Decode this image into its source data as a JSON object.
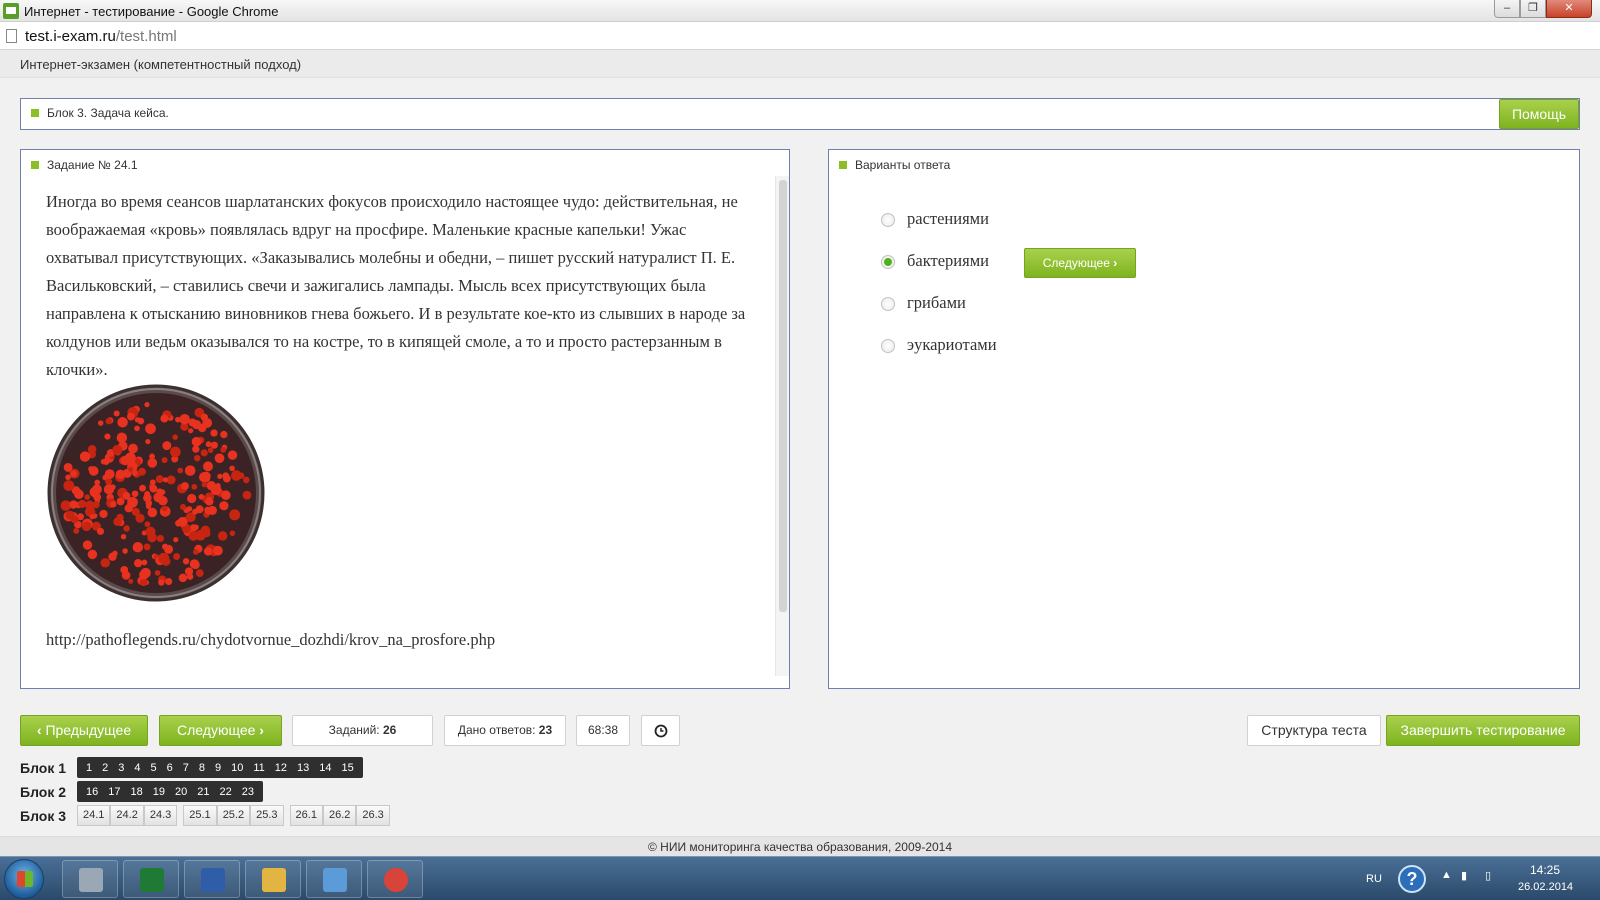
{
  "window": {
    "title": "Интернет - тестирование - Google Chrome",
    "controls": {
      "minimize": "–",
      "maximize": "❐",
      "close": "✕"
    }
  },
  "address": {
    "host": "test.i-exam.ru",
    "path": "/test.html"
  },
  "exam": {
    "name": "Интернет-экзамен (компетентностный подход)"
  },
  "block": {
    "title": "Блок 3. Задача кейса.",
    "help_label": "Помощь"
  },
  "task": {
    "title": "Задание № 24.1",
    "text": "Иногда во время сеансов шарлатанских фокусов происходило настоящее чудо: действительная, не воображаемая «кровь» появлялась вдруг на просфире. Маленькие красные капельки! Ужас охватывал присутствующих. «Заказывались молебны и обедни, – пишет русский натуралист П. Е. Васильковский, – ставились свечи и зажигались лампады. Мысль всех присутствующих была направлена к отысканию виновников гнева божьего. И в результате кое-кто из слывших в народе за колдунов или ведьм оказывался то на костре, то в кипящей смоле, а то и просто растерзанным в клочки».",
    "link": "http://pathoflegends.ru/chydotvornue_dozhdi/krov_na_prosfore.php"
  },
  "answers": {
    "title": "Варианты ответа",
    "options": [
      {
        "label": "растениями",
        "selected": false
      },
      {
        "label": "бактериями",
        "selected": true
      },
      {
        "label": "грибами",
        "selected": false
      },
      {
        "label": "эукариотами",
        "selected": false
      }
    ],
    "next_inline_label": "Следующее"
  },
  "nav": {
    "prev_label": "Предыдущее",
    "next_label": "Следующее",
    "tasks_label": "Заданий:",
    "tasks_count": "26",
    "answered_label": "Дано ответов:",
    "answered_count": "23",
    "timer": "68:38",
    "structure_label": "Структура теста",
    "finish_label": "Завершить тестирование"
  },
  "blocks": {
    "block1": {
      "label": "Блок 1",
      "items": [
        "1",
        "2",
        "3",
        "4",
        "5",
        "6",
        "7",
        "8",
        "9",
        "10",
        "11",
        "12",
        "13",
        "14",
        "15"
      ]
    },
    "block2": {
      "label": "Блок 2",
      "items": [
        "16",
        "17",
        "18",
        "19",
        "20",
        "21",
        "22",
        "23"
      ]
    },
    "block3": {
      "label": "Блок 3",
      "groups": [
        [
          "24.1",
          "24.2",
          "24.3"
        ],
        [
          "25.1",
          "25.2",
          "25.3"
        ],
        [
          "26.1",
          "26.2",
          "26.3"
        ]
      ]
    }
  },
  "footer": {
    "text": "© НИИ мониторинга качества образования, 2009-2014"
  },
  "taskbar": {
    "apps": [
      "calculator-icon",
      "excel-icon",
      "word-icon",
      "explorer-icon",
      "media-icon",
      "chrome-icon"
    ],
    "colors": {
      "calculator": "#9aa7b5",
      "excel": "#1f7a35",
      "word": "#2f5da8",
      "explorer": "#e2b441",
      "media": "#5b9bd8",
      "chrome": "#d9443a"
    },
    "lang": "RU",
    "time": "14:25",
    "date": "26.02.2014"
  }
}
